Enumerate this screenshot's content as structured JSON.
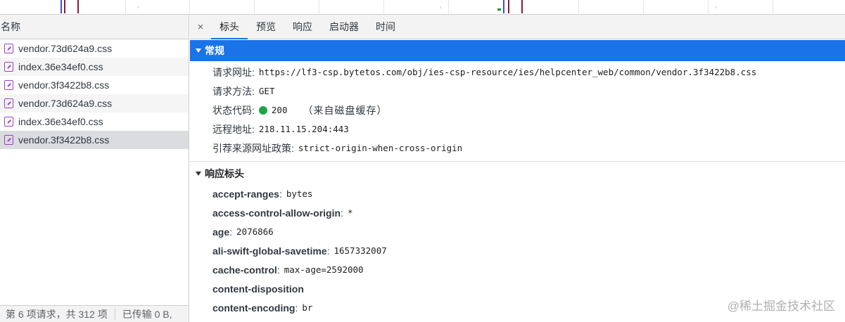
{
  "timeline": {
    "accent_red": "#8b1a3a",
    "accent_blue": "#3a4fd8",
    "accent_green": "#1e8e3e"
  },
  "left_panel": {
    "header": "名称",
    "requests": [
      {
        "name": "vendor.73d624a9.css",
        "icon": "css-file-icon"
      },
      {
        "name": "index.36e34ef0.css",
        "icon": "css-file-icon"
      },
      {
        "name": "vendor.3f3422b8.css",
        "icon": "css-file-icon"
      },
      {
        "name": "vendor.73d624a9.css",
        "icon": "css-file-icon"
      },
      {
        "name": "index.36e34ef0.css",
        "icon": "css-file-icon"
      },
      {
        "name": "vendor.3f3422b8.css",
        "icon": "css-file-icon",
        "selected": true
      }
    ],
    "footer": {
      "requests": "第 6 项请求，共 312 项",
      "transferred": "已传输 0 B,"
    }
  },
  "detail": {
    "close": "×",
    "tabs": [
      "标头",
      "预览",
      "响应",
      "启动器",
      "时间"
    ],
    "active_tab": "标头",
    "general": {
      "title": "常规",
      "url_label": "请求网址",
      "url": "https://lf3-csp.bytetos.com/obj/ies-csp-resource/ies/helpcenter_web/common/vendor.3f3422b8.css",
      "method_label": "请求方法",
      "method": "GET",
      "status_label": "状态代码",
      "status": "200",
      "status_note": "（来自磁盘缓存）",
      "remote_label": "远程地址",
      "remote": "218.11.15.204:443",
      "referrer_label": "引荐来源网址政策",
      "referrer": "strict-origin-when-cross-origin"
    },
    "response_headers": {
      "title": "响应标头",
      "items": [
        {
          "name": "accept-ranges",
          "value": "bytes"
        },
        {
          "name": "access-control-allow-origin",
          "value": "*"
        },
        {
          "name": "age",
          "value": "2076866"
        },
        {
          "name": "ali-swift-global-savetime",
          "value": "1657332007"
        },
        {
          "name": "cache-control",
          "value": "max-age=2592000"
        },
        {
          "name": "content-disposition",
          "value": ""
        },
        {
          "name": "content-encoding",
          "value": "br"
        }
      ]
    }
  },
  "watermark": "@稀土掘金技术社区",
  "colors": {
    "accent": "#1a73e8",
    "status_ok": "#1ea446",
    "css_icon": "#a03ec8"
  }
}
